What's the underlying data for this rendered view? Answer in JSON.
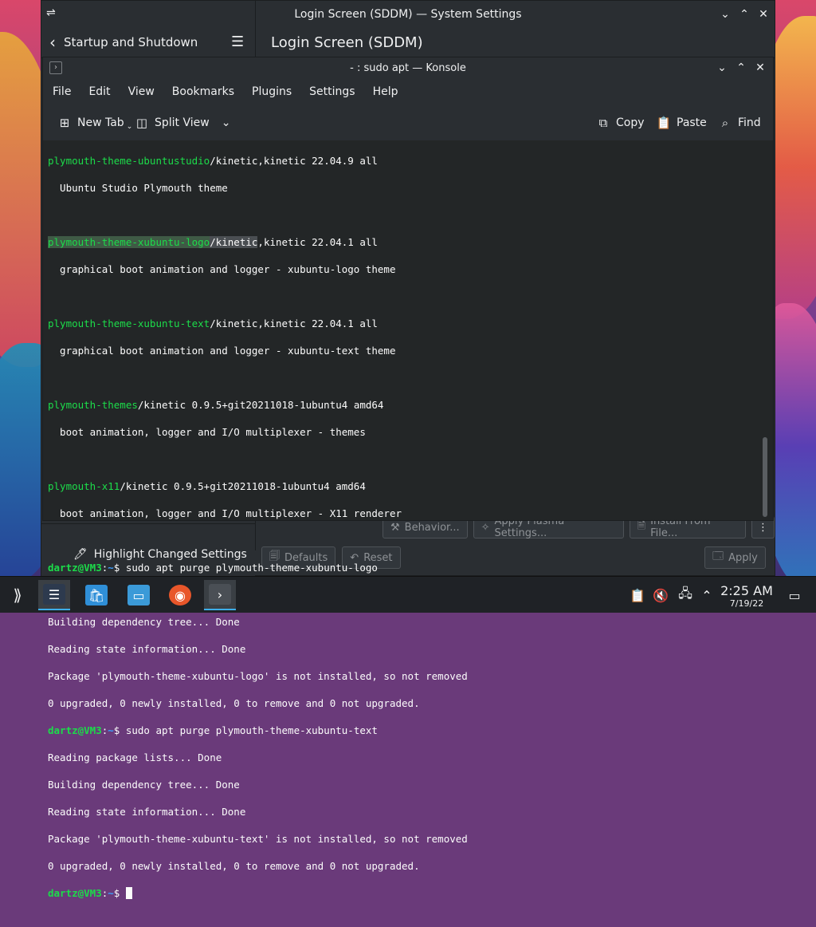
{
  "settings": {
    "title": "Login Screen (SDDM) — System Settings",
    "back_label": "Startup and Shutdown",
    "page_title": "Login Screen (SDDM)",
    "highlight_label": "Highlight Changed Settings",
    "behavior_label": "Behavior...",
    "apply_plasma_label": "Apply Plasma Settings...",
    "install_label": "Install From File...",
    "defaults_label": "Defaults",
    "reset_label": "Reset",
    "apply_label": "Apply"
  },
  "konsole": {
    "title": "- : sudo apt — Konsole",
    "menu": [
      "File",
      "Edit",
      "View",
      "Bookmarks",
      "Plugins",
      "Settings",
      "Help"
    ],
    "toolbar": {
      "new_tab": "New Tab",
      "split_view": "Split View",
      "copy": "Copy",
      "paste": "Paste",
      "find": "Find"
    }
  },
  "terminal": {
    "l1_pkg": "plymouth-theme-ubuntustudio",
    "l1_rest": "/kinetic,kinetic 22.04.9 all",
    "l2": "  Ubuntu Studio Plymouth theme",
    "l4_pkg": "plymouth-theme-xubuntu-logo",
    "l4_slash": "/",
    "l4_kinetic": "kinetic",
    "l4_rest": ",kinetic 22.04.1 all",
    "l5": "  graphical boot animation and logger - xubuntu-logo theme",
    "l7_pkg": "plymouth-theme-xubuntu-text",
    "l7_rest": "/kinetic,kinetic 22.04.1 all",
    "l8": "  graphical boot animation and logger - xubuntu-text theme",
    "l10_pkg": "plymouth-themes",
    "l10_rest": "/kinetic 0.9.5+git20211018-1ubuntu4 amd64",
    "l11": "  boot animation, logger and I/O multiplexer - themes",
    "l13_pkg": "plymouth-x11",
    "l13_rest": "/kinetic 0.9.5+git20211018-1ubuntu4 amd64",
    "l14": "  boot animation, logger and I/O multiplexer - X11 renderer",
    "prompt_user": "dartz@VM3",
    "prompt_sep": ":",
    "prompt_path": "~",
    "prompt_sym": "$ ",
    "cmd1": "sudo apt purge plymouth-theme-xubuntu-logo",
    "reading_lists": "Reading package lists... Done",
    "building_tree": "Building dependency tree... Done",
    "reading_state": "Reading state information... Done",
    "not_installed_logo": "Package 'plymouth-theme-xubuntu-logo' is not installed, so not removed",
    "summary": "0 upgraded, 0 newly installed, 0 to remove and 0 not upgraded.",
    "cmd2": "sudo apt purge plymouth-theme-xubuntu-text",
    "not_installed_text": "Package 'plymouth-theme-xubuntu-text' is not installed, so not removed"
  },
  "taskbar": {
    "time": "2:25 AM",
    "date": "7/19/22"
  },
  "colors": {
    "accent": "#3daee9",
    "terminal_green": "#1cdc4a",
    "terminal_blue": "#3d9dfc"
  }
}
